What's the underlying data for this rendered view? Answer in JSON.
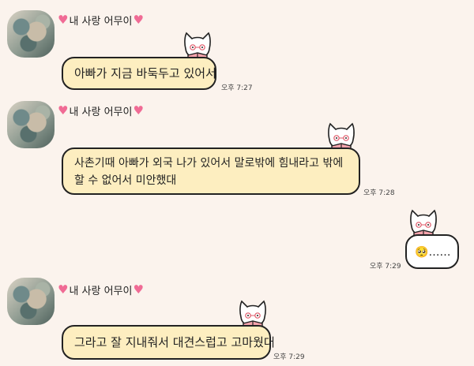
{
  "messages": [
    {
      "sender": "내 사랑 어무이",
      "lines": [
        "아빠가 지금 바둑두고 있어서"
      ],
      "time": "오후 7:27"
    },
    {
      "sender": "내 사랑 어무이",
      "lines": [
        "사촌기때 아빠가 외국 나가 있어서 말로밖에 힘내라고 밖에",
        "할 수 없어서 미안했대"
      ],
      "time": "오후 7:28"
    },
    {
      "sender": "me",
      "emoji": "🥺",
      "text": "……",
      "time": "오후 7:29"
    },
    {
      "sender": "내 사랑 어무이",
      "lines": [
        "그라고 잘 지내줘서 대견스럽고 고마웠대"
      ],
      "time": "오후 7:29"
    }
  ],
  "icons": {
    "heart": "heart-icon",
    "sticker": "reading-cat-icon",
    "avatar": "profile-photo"
  },
  "colors": {
    "background": "#fbf3ed",
    "bubble_received": "#fdeec0",
    "bubble_sent": "#ffffff",
    "border": "#222222",
    "heart": "#f06b95"
  }
}
